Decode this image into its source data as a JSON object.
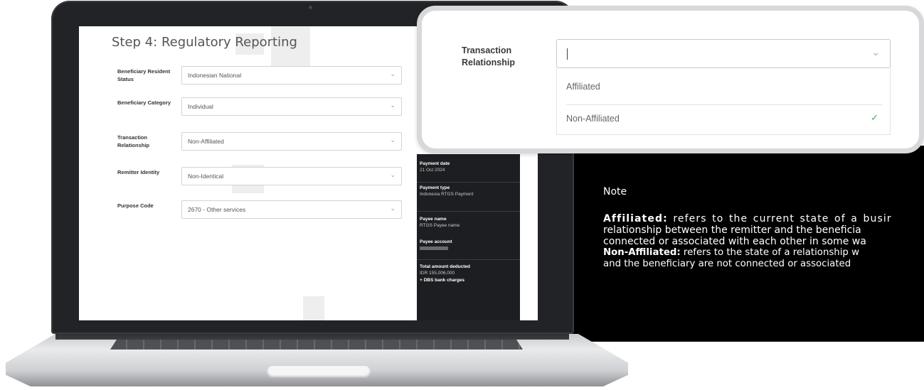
{
  "screen": {
    "step_title": "Step 4: Regulatory Reporting",
    "fields": [
      {
        "label": "Beneficiary Resident Status",
        "value": "Indonesian National"
      },
      {
        "label": "Beneficiary Category",
        "value": "Individual"
      },
      {
        "label": "Transaction Relationship",
        "value": "Non-Affiliated"
      },
      {
        "label": "Remitter Identity",
        "value": "Non-Identical"
      },
      {
        "label": "Purpose Code",
        "value": "2670 - Other services"
      }
    ],
    "summary": {
      "payment_date_label": "Payment date",
      "payment_date_value": "21 Oct 2024",
      "payment_type_label": "Payment type",
      "payment_type_value": "Indonesia RTGS Payment",
      "payee_name_label": "Payee name",
      "payee_name_value": "RTGS Payee name",
      "payee_account_label": "Payee account",
      "total_label": "Total amount deducted",
      "total_value": "IDR 155,006,000",
      "charges_label": "+ DBS bank charges"
    }
  },
  "zoom": {
    "label": "Transaction Relationship",
    "input_value": "",
    "options": [
      "Affiliated",
      "Non-Affiliated"
    ],
    "selected": "Non-Affiliated"
  },
  "note": {
    "title": "Note",
    "affiliated_term": "Affiliated:",
    "affiliated_line1": "refers to the current state of a busir",
    "affiliated_line2": "relationship between the remitter and the beneficia",
    "affiliated_line3": "connected or associated with each other in some wa",
    "non_affiliated_term": "Non-Affiliated:",
    "non_affiliated_line1": "refers to the state of a relationship w",
    "non_affiliated_line2": "and the beneficiary are not connected or associated"
  },
  "colors": {
    "note_bg": "#000000",
    "check": "#3bb54a",
    "summary_bg": "#1d1e21"
  }
}
